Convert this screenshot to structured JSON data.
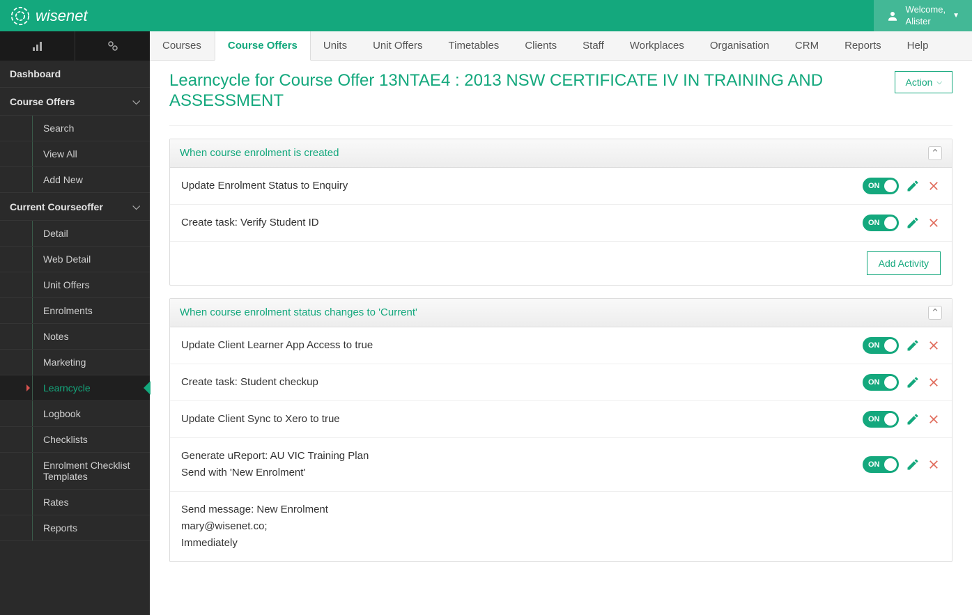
{
  "brand": "wisenet",
  "welcome": {
    "line1": "Welcome,",
    "name": "Alister"
  },
  "tabs": [
    "Courses",
    "Course Offers",
    "Units",
    "Unit Offers",
    "Timetables",
    "Clients",
    "Staff",
    "Workplaces",
    "Organisation",
    "CRM",
    "Reports",
    "Help"
  ],
  "active_tab": "Course Offers",
  "sidebar": {
    "dashboard": "Dashboard",
    "course_offers": "Course Offers",
    "co_items": [
      "Search",
      "View All",
      "Add New"
    ],
    "current": "Current Courseoffer",
    "current_items": [
      "Detail",
      "Web Detail",
      "Unit Offers",
      "Enrolments",
      "Notes",
      "Marketing",
      "Learncycle",
      "Logbook",
      "Checklists",
      "Enrolment Checklist Templates",
      "Rates",
      "Reports"
    ],
    "active_sub": "Learncycle"
  },
  "page_title": "Learncycle for Course Offer 13NTAE4 : 2013 NSW CERTIFICATE IV IN TRAINING AND ASSESSMENT",
  "action_label": "Action",
  "toggle_label": "ON",
  "add_activity_label": "Add Activity",
  "sections": [
    {
      "title": "When course enrolment is created",
      "activities": [
        {
          "lines": [
            "Update Enrolment Status to Enquiry"
          ]
        },
        {
          "lines": [
            "Create task: Verify Student ID"
          ]
        }
      ],
      "show_add": true
    },
    {
      "title": "When course enrolment status changes to 'Current'",
      "activities": [
        {
          "lines": [
            "Update Client Learner App Access to true"
          ]
        },
        {
          "lines": [
            "Create task: Student checkup"
          ]
        },
        {
          "lines": [
            "Update Client Sync to Xero to true"
          ]
        },
        {
          "lines": [
            "Generate uReport: AU VIC Training Plan",
            "Send with 'New Enrolment'"
          ]
        },
        {
          "lines": [
            "Send message: New Enrolment",
            "mary@wisenet.co;",
            "Immediately"
          ],
          "no_controls": true
        }
      ],
      "show_add": false
    }
  ]
}
